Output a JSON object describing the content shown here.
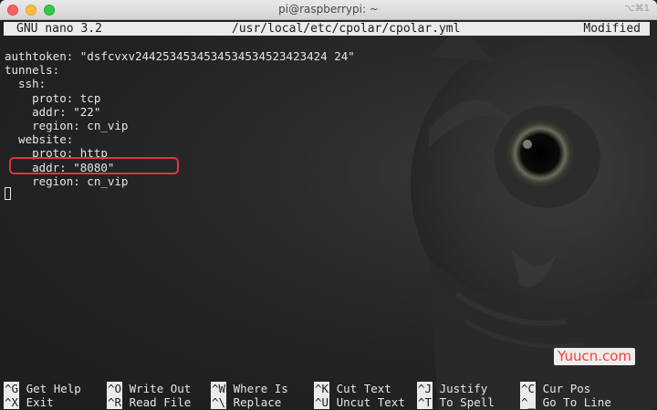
{
  "window": {
    "title": "pi@raspberrypi: ~",
    "shortcut": "⌥⌘1"
  },
  "nano": {
    "version": "GNU nano 3.2",
    "file_path": "/usr/local/etc/cpolar/cpolar.yml",
    "status": "Modified"
  },
  "editor": {
    "lines": [
      "authtoken: \"dsfcvxv2442534534534534534523423424 24\"",
      "tunnels:",
      "  ssh:",
      "    proto: tcp",
      "    addr: \"22\"",
      "    region: cn_vip",
      "  website:",
      "    proto: http",
      "    addr: \"8080\"",
      "    region: cn_vip"
    ]
  },
  "shortcuts": {
    "row1": [
      {
        "key": "^G",
        "label": "Get Help"
      },
      {
        "key": "^O",
        "label": "Write Out"
      },
      {
        "key": "^W",
        "label": "Where Is"
      },
      {
        "key": "^K",
        "label": "Cut Text"
      },
      {
        "key": "^J",
        "label": "Justify"
      },
      {
        "key": "^C",
        "label": "Cur Pos"
      }
    ],
    "row2": [
      {
        "key": "^X",
        "label": "Exit"
      },
      {
        "key": "^R",
        "label": "Read File"
      },
      {
        "key": "^\\",
        "label": "Replace"
      },
      {
        "key": "^U",
        "label": "Uncut Text"
      },
      {
        "key": "^T",
        "label": "To Spell"
      },
      {
        "key": "^_",
        "label": "Go To Line"
      }
    ]
  },
  "watermark": "Yuucn.com",
  "colors": {
    "highlight_box": "#e0353f",
    "terminal_bg": "#222222",
    "bar_bg": "#ebebeb"
  }
}
